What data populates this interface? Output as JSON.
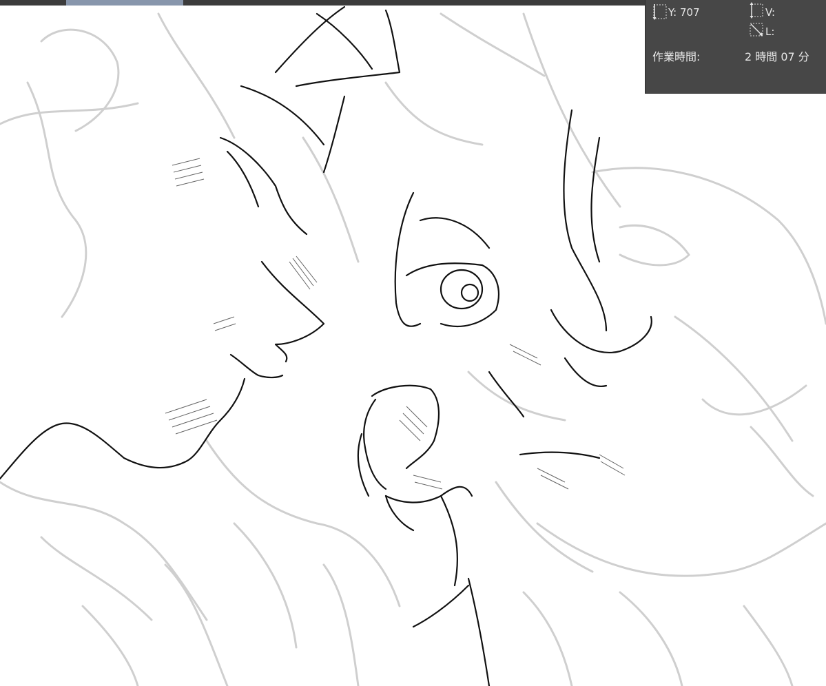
{
  "window": {
    "top_bar_color": "#3c3c3c",
    "active_tab_color": "#8896ac"
  },
  "canvas": {
    "content": "sketch-drawing",
    "background_color": "#ffffff",
    "line_color": "#000000",
    "sketch_color": "#c8c8c8"
  },
  "info_panel": {
    "background_color": "#474747",
    "y_label": "Y: 707",
    "v_label": "V:",
    "l_label": "L:",
    "work_time_label": "作業時間:",
    "work_time_value": "2 時間 07 分",
    "icons": [
      "height-dimension-icon",
      "vertical-dimension-icon",
      "diagonal-length-icon"
    ]
  }
}
